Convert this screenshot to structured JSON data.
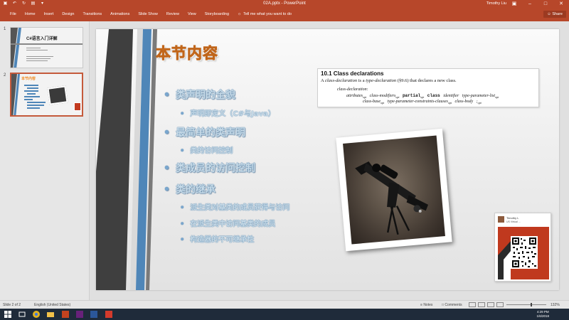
{
  "window": {
    "title": "02A.pptx - PowerPoint",
    "user": "Timothy Liu"
  },
  "ribbon": {
    "tabs": [
      "File",
      "Home",
      "Insert",
      "Design",
      "Transitions",
      "Animations",
      "Slide Show",
      "Review",
      "View",
      "Storyboarding"
    ],
    "tell_me": "Tell me what you want to do",
    "share": "Share"
  },
  "thumbnails": [
    {
      "number": "1",
      "title": "C#语言入门详解"
    },
    {
      "number": "2",
      "title": "本节内容"
    }
  ],
  "slide": {
    "title": "本节内容",
    "bullets": [
      {
        "level": 1,
        "text": "类声明的全貌"
      },
      {
        "level": 2,
        "text": "声明即定义（C#与Java）"
      },
      {
        "level": 1,
        "text": "最简单的类声明"
      },
      {
        "level": 2,
        "text": "类的访问控制"
      },
      {
        "level": 1,
        "text": "类成员的访问控制"
      },
      {
        "level": 1,
        "text": "类的继承"
      },
      {
        "level": 2,
        "text": "派生类对基类的成员获得与访问"
      },
      {
        "level": 2,
        "text": "在派生类中访问基类的成员"
      },
      {
        "level": 2,
        "text": "构造器的不可继承性"
      }
    ],
    "class_decl": {
      "heading": "10.1 Class declarations",
      "para_prefix": "A ",
      "para_term": "class-declaration",
      "para_mid": " is a ",
      "para_term2": "type-declaration",
      "para_suffix": " (§9.6) that declares a new class.",
      "grammar_name": "class-declaration:",
      "row1_a": "attributes",
      "row1_b": "class-modifiers",
      "row1_kw1": "partial",
      "row1_kw2": "class",
      "row1_c": "identifier",
      "row1_d": "type-parameter-list",
      "row2_a": "class-base",
      "row2_b": "type-parameter-constraints-clauses",
      "row2_c": "class-body",
      "row2_d": ";",
      "opt": "opt"
    },
    "wechat": {
      "name": "Timothy L",
      "location": "US Virtual ..."
    }
  },
  "statusbar": {
    "slide_info": "Slide 2 of 2",
    "language": "English (United States)",
    "notes": "Notes",
    "comments": "Comments",
    "zoom": "132%"
  },
  "taskbar": {
    "time": "4:29 PM",
    "date": "1/6/2018"
  }
}
